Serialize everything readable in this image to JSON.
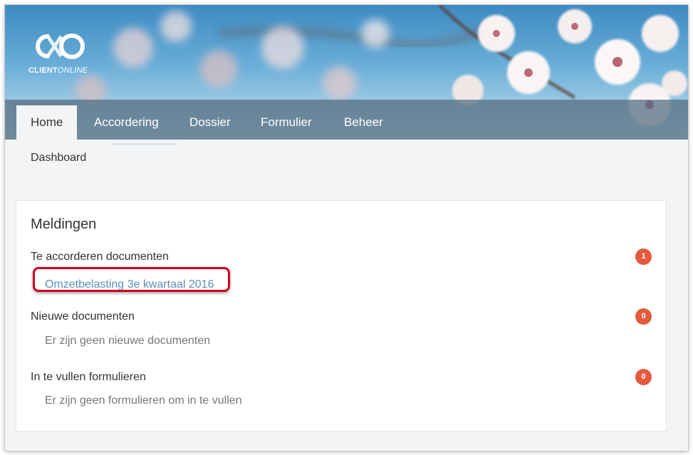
{
  "brand": {
    "logo_strong": "CLIENT",
    "logo_light": "ONLINE"
  },
  "nav": {
    "items": [
      {
        "label": "Home",
        "active": true
      },
      {
        "label": "Accordering",
        "active": false
      },
      {
        "label": "Dossier",
        "active": false
      },
      {
        "label": "Formulier",
        "active": false
      },
      {
        "label": "Beheer",
        "active": false
      }
    ]
  },
  "subnav": {
    "dashboard_label": "Dashboard"
  },
  "notifications": {
    "title": "Meldingen",
    "sections": [
      {
        "label": "Te accorderen documenten",
        "count": "1",
        "link": "Omzetbelasting 3e kwartaal 2016"
      },
      {
        "label": "Nieuwe documenten",
        "count": "0",
        "empty": "Er zijn geen nieuwe documenten"
      },
      {
        "label": "In te vullen formulieren",
        "count": "0",
        "empty": "Er zijn geen formulieren om in te vullen"
      }
    ]
  },
  "colors": {
    "badge": "#e45a3e",
    "link": "#5b8fb8",
    "highlight": "#d0021b"
  }
}
